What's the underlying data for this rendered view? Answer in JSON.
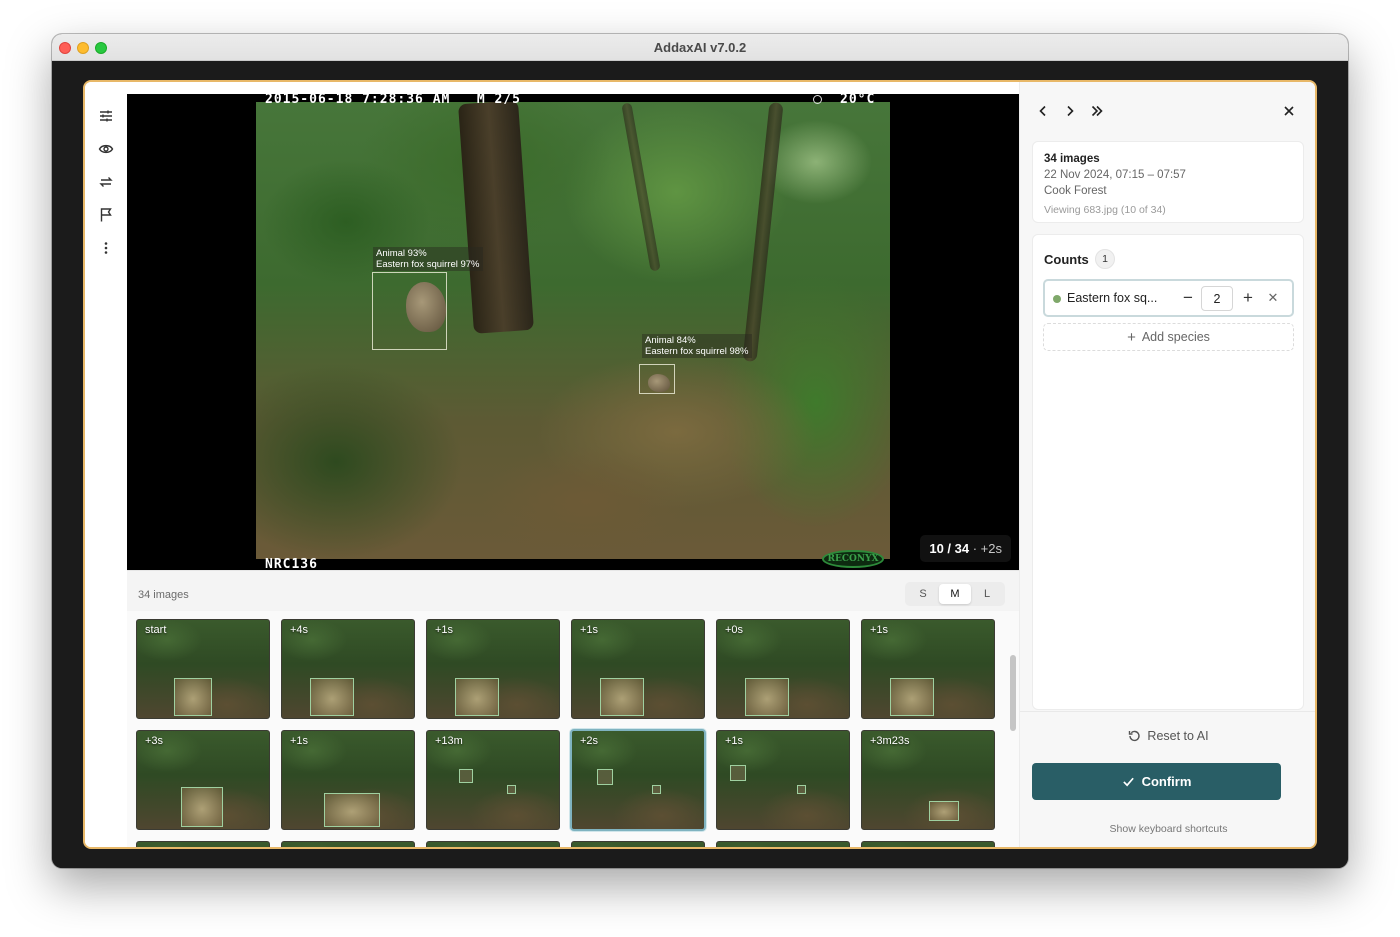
{
  "window": {
    "title": "AddaxAI v7.0.2"
  },
  "toolrail": {
    "items": [
      {
        "icon": "sliders-icon"
      },
      {
        "icon": "eye-icon"
      },
      {
        "icon": "swap-icon"
      },
      {
        "icon": "flag-icon"
      },
      {
        "icon": "more-vertical-icon"
      }
    ]
  },
  "viewer": {
    "hud_top": "2015-06-18 7:28:36 AM   M 2/5",
    "hud_temp": "20°C",
    "hud_bottom": "NRC136",
    "brand": "RECONYX",
    "detections": [
      {
        "line1": "Animal 93%",
        "line2": "Eastern fox squirrel 97%"
      },
      {
        "line1": "Animal 84%",
        "line2": "Eastern fox squirrel 98%"
      }
    ],
    "position": "10 / 34",
    "offset": "· +2s"
  },
  "filmstrip": {
    "count_label": "34 images",
    "sizes": [
      "S",
      "M",
      "L"
    ],
    "active_size": "M",
    "thumbs": [
      {
        "label": "start"
      },
      {
        "label": "+4s"
      },
      {
        "label": "+1s"
      },
      {
        "label": "+1s"
      },
      {
        "label": "+0s"
      },
      {
        "label": "+1s"
      },
      {
        "label": "+3s"
      },
      {
        "label": "+1s"
      },
      {
        "label": "+13m"
      },
      {
        "label": "+2s",
        "selected": true
      },
      {
        "label": "+1s"
      },
      {
        "label": "+3m23s"
      }
    ]
  },
  "sidebar": {
    "info": {
      "title": "34 images",
      "date_range": "22 Nov 2024, 07:15 – 07:57",
      "location": "Cook Forest",
      "viewing": "Viewing 683.jpg (10 of 34)"
    },
    "counts": {
      "title": "Counts",
      "badge": "1",
      "species": [
        {
          "name": "Eastern fox sq...",
          "quantity": "2",
          "color": "#7fa86a"
        }
      ],
      "add_label": "Add species"
    },
    "reset_label": "Reset to AI",
    "confirm_label": "Confirm",
    "shortcuts_label": "Show keyboard shortcuts"
  }
}
